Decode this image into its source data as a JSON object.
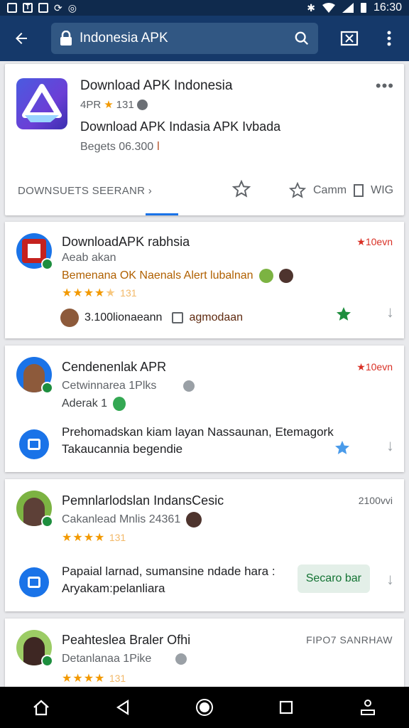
{
  "status_bar": {
    "time": "16:30"
  },
  "app_bar": {
    "search_text": "Indonesia APK"
  },
  "hero": {
    "title": "Download APK Indonesia",
    "meta_rating": "4PR",
    "meta_count": "131",
    "subtitle": "Download APK Indasia APK Ivbada",
    "size": "Begets 06.300",
    "link_label": "DOWNSUETS SEERANR",
    "action_label": "Camm",
    "action_tag": "WIG"
  },
  "results": [
    {
      "title": "DownloadAPK rabhsia",
      "time": "10evn",
      "subtitle": "Aeab akan",
      "line": "Bemenana OK Naenals Alert lubalnan",
      "rating_count": "131",
      "footer_text": "3.100lionaeann",
      "footer_tag": "agmodaan"
    },
    {
      "title": "Cendenenlak APR",
      "time": "10evn",
      "subtitle": "Cetwinnarea 1Plks",
      "line": "Aderak 1",
      "desc1": "Prehomadskan kiam layan Nassaunan, Etemagork",
      "desc2": "Takaucannia begendie"
    },
    {
      "title": "Pemnlarlodslan IndansCesic",
      "time": "2100vvi",
      "subtitle": "Cakanlead Mnlis 24361",
      "rating_count": "131",
      "desc1": "Papaial larnad, sumansine ndade hara :",
      "desc2": "Aryakam:pelanliara",
      "pill": "Secaro bar"
    },
    {
      "title": "Peahteslea Braler Ofhi",
      "time": "FIPO7 SANRHAW",
      "subtitle": "Detanlanaa 1Pike",
      "rating_count": "131"
    }
  ],
  "colors": {
    "accent": "#15396a",
    "status": "#0f2a4d",
    "star": "#f29900",
    "green": "#1e8e3e"
  }
}
